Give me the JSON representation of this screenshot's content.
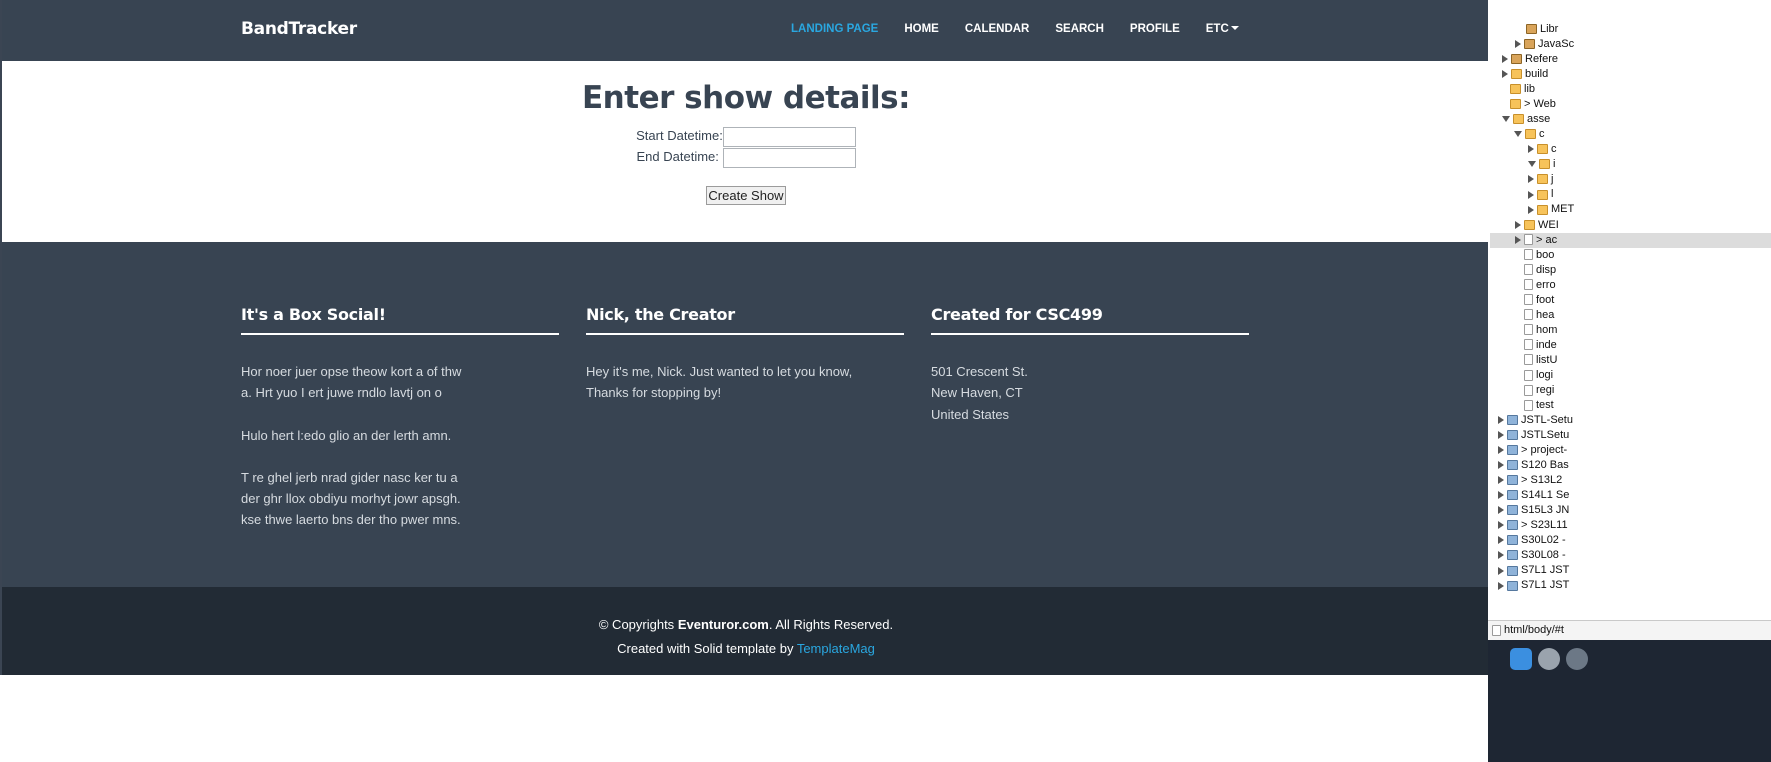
{
  "navbar": {
    "brand": "BandTracker",
    "items": [
      {
        "label": "LANDING PAGE",
        "active": true
      },
      {
        "label": "HOME",
        "active": false
      },
      {
        "label": "CALENDAR",
        "active": false
      },
      {
        "label": "SEARCH",
        "active": false
      },
      {
        "label": "PROFILE",
        "active": false
      },
      {
        "label": "ETC",
        "active": false,
        "has_caret": true
      }
    ]
  },
  "form": {
    "title": "Enter show details:",
    "start_label": "Start Datetime:",
    "start_value": "",
    "end_label": "End Datetime:",
    "end_value": "",
    "submit_label": "Create Show"
  },
  "footer": {
    "col1": {
      "heading": "It's a Box Social!",
      "p1a": "Hor noer juer opse theow kort a of thw",
      "p1b": "a. Hrt yuo I ert juwe rndlo lavtj on o",
      "p2": "Hulo hert l:edo glio an der lerth amn.",
      "p3a": "T re ghel jerb nrad gider nasc ker tu a",
      "p3b": "der ghr llox obdiyu morhyt jowr apsgh.",
      "p3c": "kse thwe laerto bns der tho pwer mns."
    },
    "col2": {
      "heading": "Nick, the Creator",
      "line1": "Hey it's me, Nick. Just wanted to let you know,",
      "line2": "Thanks for stopping by!"
    },
    "col3": {
      "heading": "Created for CSC499",
      "line1": "501 Crescent St.",
      "line2": "New Haven, CT",
      "line3": "United States"
    }
  },
  "copyright": {
    "prefix": "© Copyrights ",
    "site": "Eventuror.com",
    "suffix": ". All Rights Reserved.",
    "created_prefix": "Created with Solid template by ",
    "created_link": "TemplateMag"
  },
  "ide": {
    "tree": [
      {
        "label": "Libr",
        "icon": "lib"
      },
      {
        "label": "JavaSc",
        "icon": "lib"
      },
      {
        "label": "Refere",
        "icon": "lib"
      },
      {
        "label": "build",
        "icon": "folder"
      },
      {
        "label": "lib",
        "icon": "folder"
      },
      {
        "label": "> Web",
        "icon": "folder"
      },
      {
        "label": "asse",
        "icon": "folder"
      },
      {
        "label": "c",
        "icon": "folder"
      },
      {
        "label": "c",
        "icon": "folder"
      },
      {
        "label": "i",
        "icon": "folder"
      },
      {
        "label": "j",
        "icon": "folder"
      },
      {
        "label": "l",
        "icon": "folder"
      },
      {
        "label": "MET",
        "icon": "folder"
      },
      {
        "label": "WEI",
        "icon": "folder"
      },
      {
        "label": "> ac",
        "icon": "file"
      },
      {
        "label": "boo",
        "icon": "file"
      },
      {
        "label": "disp",
        "icon": "file"
      },
      {
        "label": "erro",
        "icon": "file"
      },
      {
        "label": "foot",
        "icon": "file"
      },
      {
        "label": "hea",
        "icon": "file"
      },
      {
        "label": "hom",
        "icon": "file"
      },
      {
        "label": "inde",
        "icon": "file"
      },
      {
        "label": "listU",
        "icon": "file"
      },
      {
        "label": "logi",
        "icon": "file"
      },
      {
        "label": "regi",
        "icon": "file"
      },
      {
        "label": "test",
        "icon": "file"
      },
      {
        "label": "JSTL-Setu",
        "icon": "proj"
      },
      {
        "label": "JSTLSetu",
        "icon": "proj"
      },
      {
        "label": "> project-",
        "icon": "proj"
      },
      {
        "label": "S120 Bas",
        "icon": "proj"
      },
      {
        "label": "> S13L2 ",
        "icon": "proj"
      },
      {
        "label": "S14L1 Se",
        "icon": "proj"
      },
      {
        "label": "S15L3 JN",
        "icon": "proj"
      },
      {
        "label": "> S23L11",
        "icon": "proj"
      },
      {
        "label": "S30L02 -",
        "icon": "proj"
      },
      {
        "label": "S30L08 -",
        "icon": "proj"
      },
      {
        "label": "S7L1 JST",
        "icon": "proj"
      },
      {
        "label": "S7L1 JST",
        "icon": "proj"
      }
    ],
    "status_path": "html/body/#t"
  }
}
